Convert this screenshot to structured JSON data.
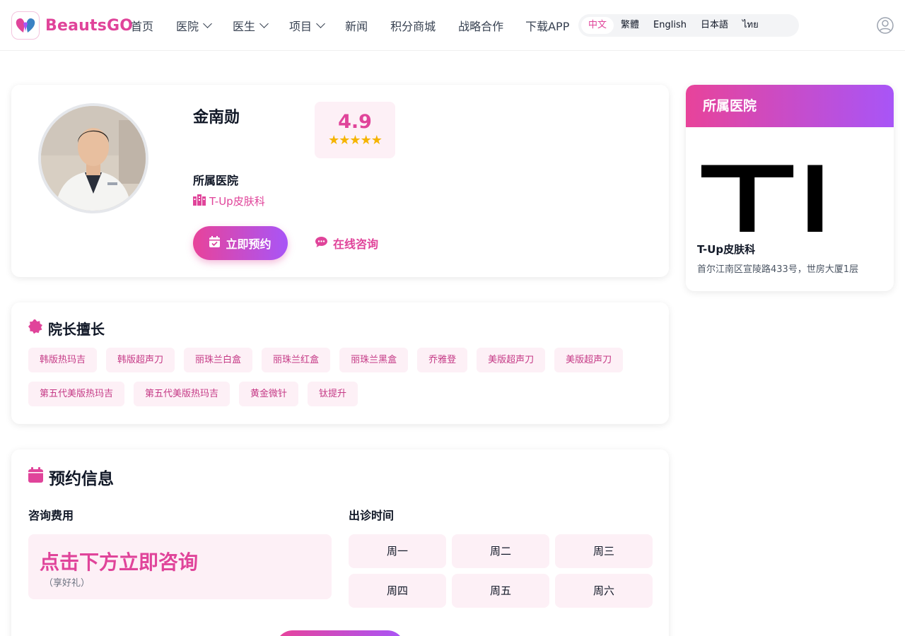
{
  "brand": {
    "name": "BeautsGO",
    "accent": "#e0449a",
    "gradient_start": "#e8439a",
    "gradient_end": "#a855f7"
  },
  "nav": {
    "items": [
      {
        "label": "首页",
        "dropdown": false
      },
      {
        "label": "医院",
        "dropdown": true
      },
      {
        "label": "医生",
        "dropdown": true
      },
      {
        "label": "项目",
        "dropdown": true
      },
      {
        "label": "新闻",
        "dropdown": false
      },
      {
        "label": "积分商城",
        "dropdown": false
      },
      {
        "label": "战略合作",
        "dropdown": false
      },
      {
        "label": "下载APP",
        "dropdown": false
      }
    ],
    "languages": [
      "中文",
      "繁體",
      "English",
      "日本語",
      "ไทย"
    ],
    "active_language": "中文",
    "user_icon": "user-circle-icon"
  },
  "doctor": {
    "name": "金南勋",
    "rating": "4.9",
    "stars": "★★★★★",
    "hospital_label": "所属医院",
    "hospital_name": "T-Up皮肤科",
    "book_label": "立即预约",
    "chat_label": "在线咨询"
  },
  "sidebar": {
    "title": "所属医院",
    "logo_text": "TJ",
    "hospital_name": "T-Up皮肤科",
    "address": "首尔江南区宣陵路433号，世房大厦1层"
  },
  "skills": {
    "title": "院长擅长",
    "tags": [
      "韩版热玛吉",
      "韩版超声刀",
      "丽珠兰白盒",
      "丽珠兰红盒",
      "丽珠兰黑盒",
      "乔雅登",
      "美版超声刀",
      "美版超声刀",
      "第五代美版热玛吉",
      "第五代美版热玛吉",
      "黄金微针",
      "钛提升"
    ]
  },
  "booking": {
    "title": "预约信息",
    "fee_label": "咨询费用",
    "fee_main": "点击下方立即咨询",
    "fee_sub": "（享好礼）",
    "schedule_label": "出诊时间",
    "days": [
      "周一",
      "周二",
      "周三",
      "周四",
      "周五",
      "周六"
    ]
  }
}
